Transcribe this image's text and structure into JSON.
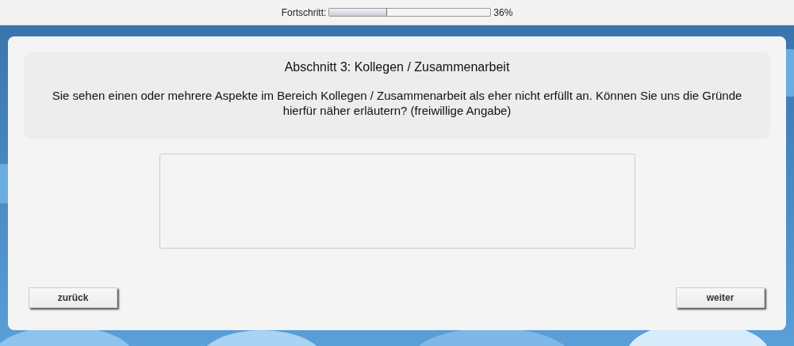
{
  "progress": {
    "label": "Fortschritt:",
    "level": 0.36,
    "reading": "36%"
  },
  "section": {
    "title": "Abschnitt 3: Kollegen / Zusammenarbeit",
    "question": "Sie sehen einen oder mehrere Aspekte im Bereich Kollegen / Zusammenarbeit als eher nicht erfüllt an. Können Sie uns die Gründe hierfür näher erläutern? (freiwillige Angabe)"
  },
  "answer": {
    "kind": "textarea"
  },
  "buttons": [
    {
      "label": "zurück"
    },
    {
      "label": "weiter"
    }
  ]
}
